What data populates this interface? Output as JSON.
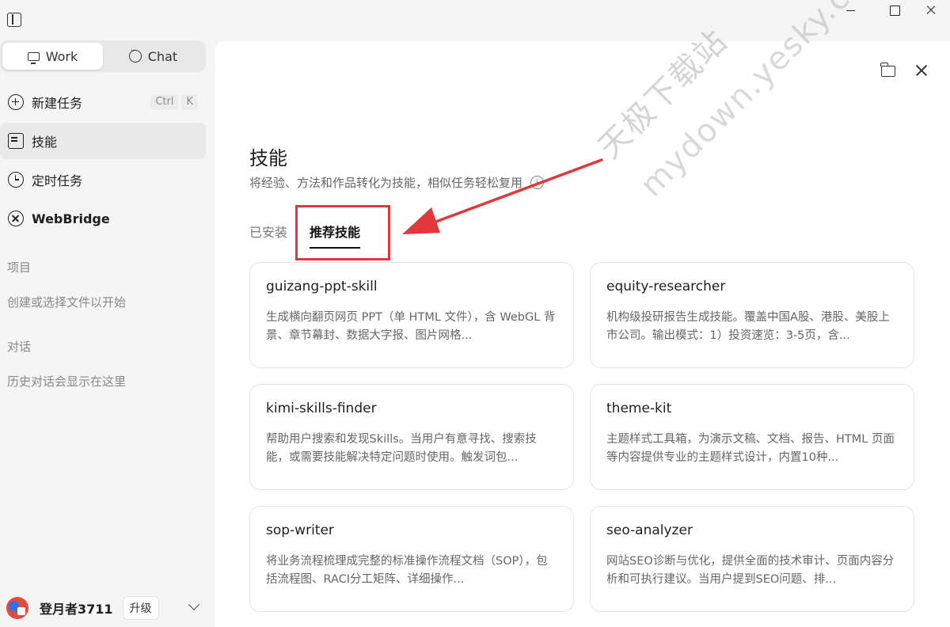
{
  "sidebar": {
    "mode_switch": {
      "work": "Work",
      "chat": "Chat"
    },
    "items": [
      {
        "label": "新建任务",
        "shortcut": [
          "Ctrl",
          "K"
        ]
      },
      {
        "label": "技能"
      },
      {
        "label": "定时任务"
      },
      {
        "label": "WebBridge"
      }
    ],
    "projects_heading": "项目",
    "projects_hint": "创建或选择文件以开始",
    "chats_heading": "对话",
    "chats_hint": "历史对话会显示在这里",
    "user": {
      "name": "登月者3711",
      "upgrade": "升级"
    }
  },
  "main": {
    "title": "技能",
    "subtitle": "将经验、方法和作品转化为技能，相似任务轻松复用",
    "info": "i",
    "tabs": [
      {
        "label": "已安装",
        "active": false
      },
      {
        "label": "推荐技能",
        "active": true
      }
    ],
    "skills": [
      {
        "name": "guizang-ppt-skill",
        "desc": "生成横向翻页网页 PPT（单 HTML 文件），含 WebGL 背景、章节幕封、数据大字报、图片网格..."
      },
      {
        "name": "equity-researcher",
        "desc": "机构级投研报告生成技能。覆盖中国A股、港股、美股上市公司。输出模式：1）投资速览：3-5页，含..."
      },
      {
        "name": "kimi-skills-finder",
        "desc": "帮助用户搜索和发现Skills。当用户有意寻找、搜索技能，或需要技能解决特定问题时使用。触发词包..."
      },
      {
        "name": "theme-kit",
        "desc": "主题样式工具箱，为演示文稿、文档、报告、HTML 页面等内容提供专业的主题样式设计，内置10种..."
      },
      {
        "name": "sop-writer",
        "desc": "将业务流程梳理成完整的标准操作流程文档（SOP），包括流程图、RACI分工矩阵、详细操作..."
      },
      {
        "name": "seo-analyzer",
        "desc": "网站SEO诊断与优化，提供全面的技术审计、页面内容分析和可执行建议。当用户提到SEO问题、排..."
      }
    ]
  },
  "watermark": {
    "line1": "天极下载站",
    "line2": "mydown.yesky.com"
  },
  "colors": {
    "annotation": "#e0383b",
    "sidebar_bg": "#f5f5f5",
    "main_bg": "#ffffff"
  }
}
